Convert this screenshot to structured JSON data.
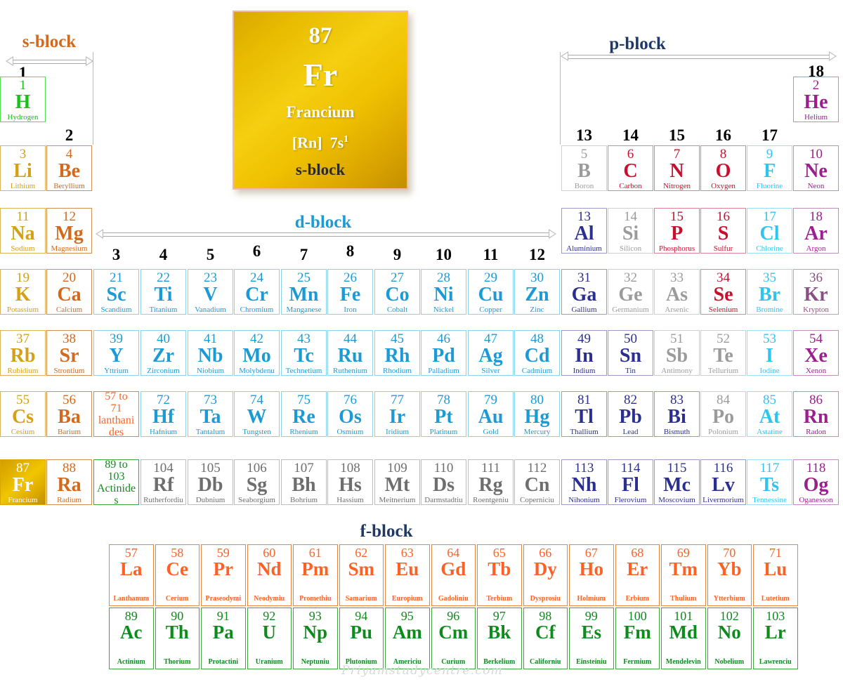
{
  "blocks": {
    "s_label": "s-block",
    "p_label": "p-block",
    "d_label": "d-block",
    "f_label": "f-block"
  },
  "colors": {
    "group1": "#d4a017",
    "group2": "#d2691e",
    "dblock": "#1c9ad6",
    "dblock_gray": "#6e6e6e",
    "hydrogen": "#18c018",
    "metal_navy": "#2b2f8f",
    "metalloid_gray": "#9b9b9b",
    "nonmetal_crimson": "#c8102e",
    "halogen_cyan": "#2ec4f0",
    "noble_purple": "#9b1f8f",
    "lanthanide_orange": "#ff6024",
    "actinide_green": "#0f8a1c",
    "card_gold": "#e8bc00",
    "card_border": "#f0b9a0"
  },
  "group_numbers": [
    "1",
    "2",
    "3",
    "4",
    "5",
    "6",
    "7",
    "8",
    "9",
    "10",
    "11",
    "12",
    "13",
    "14",
    "15",
    "16",
    "17",
    "18"
  ],
  "feature_card": {
    "number": "87",
    "symbol": "Fr",
    "name": "Francium",
    "config_core": "[Rn]",
    "config_orbital": "7s",
    "config_sup": "1",
    "block": "s-block"
  },
  "placeholders": [
    {
      "line1": "57 to",
      "line2": "71",
      "line3": "lanthani",
      "line4": "des",
      "color": "#ff6024",
      "border": "#e8853c"
    },
    {
      "line1": "89 to",
      "line2": "103",
      "line3": "Actinide",
      "line4": "s",
      "color": "#0f8a1c",
      "border": "#3da83d"
    }
  ],
  "elements": [
    {
      "z": "1",
      "sym": "H",
      "name": "Hydrogen",
      "col": 1,
      "row": 1,
      "color": "#18c018",
      "border": "#4ee04e"
    },
    {
      "z": "2",
      "sym": "He",
      "name": "Helium",
      "col": 18,
      "row": 1,
      "color": "#9b1f8f",
      "border": "#c08fc0"
    },
    {
      "z": "3",
      "sym": "Li",
      "name": "Lithium",
      "col": 1,
      "row": 2,
      "color": "#d4a017",
      "border": "#d9b45a"
    },
    {
      "z": "4",
      "sym": "Be",
      "name": "Beryllium",
      "col": 2,
      "row": 2,
      "color": "#d2691e",
      "border": "#cf9052"
    },
    {
      "z": "5",
      "sym": "B",
      "name": "Boron",
      "col": 13,
      "row": 2,
      "color": "#9b9b9b",
      "border": "#cfcfcf"
    },
    {
      "z": "6",
      "sym": "C",
      "name": "Carbon",
      "col": 14,
      "row": 2,
      "color": "#c8102e",
      "border": "#e08296"
    },
    {
      "z": "7",
      "sym": "N",
      "name": "Nitrogen",
      "col": 15,
      "row": 2,
      "color": "#c8102e",
      "border": "#e08296"
    },
    {
      "z": "8",
      "sym": "O",
      "name": "Oxygen",
      "col": 16,
      "row": 2,
      "color": "#c8102e",
      "border": "#e08296"
    },
    {
      "z": "9",
      "sym": "F",
      "name": "Fluorine",
      "col": 17,
      "row": 2,
      "color": "#2ec4f0",
      "border": "#9adef5"
    },
    {
      "z": "10",
      "sym": "Ne",
      "name": "Neon",
      "col": 18,
      "row": 2,
      "color": "#9b1f8f",
      "border": "#c08fc0"
    },
    {
      "z": "11",
      "sym": "Na",
      "name": "Sodium",
      "col": 1,
      "row": 3,
      "color": "#d4a017",
      "border": "#d9b45a"
    },
    {
      "z": "12",
      "sym": "Mg",
      "name": "Magnesium",
      "col": 2,
      "row": 3,
      "color": "#d2691e",
      "border": "#cf9052"
    },
    {
      "z": "13",
      "sym": "Al",
      "name": "Aluminium",
      "col": 13,
      "row": 3,
      "color": "#2b2f8f",
      "border": "#9a9cc8"
    },
    {
      "z": "14",
      "sym": "Si",
      "name": "Silicon",
      "col": 14,
      "row": 3,
      "color": "#9b9b9b",
      "border": "#cfcfcf"
    },
    {
      "z": "15",
      "sym": "P",
      "name": "Phosphorus",
      "col": 15,
      "row": 3,
      "color": "#c8102e",
      "border": "#e08296"
    },
    {
      "z": "16",
      "sym": "S",
      "name": "Sulfur",
      "col": 16,
      "row": 3,
      "color": "#c8102e",
      "border": "#e08296"
    },
    {
      "z": "17",
      "sym": "Cl",
      "name": "Chlorine",
      "col": 17,
      "row": 3,
      "color": "#2ec4f0",
      "border": "#9adef5"
    },
    {
      "z": "18",
      "sym": "Ar",
      "name": "Argon",
      "col": 18,
      "row": 3,
      "color": "#9b1f8f",
      "border": "#c08fc0"
    },
    {
      "z": "19",
      "sym": "K",
      "name": "Potassium",
      "col": 1,
      "row": 4,
      "color": "#d4a017",
      "border": "#d9b45a"
    },
    {
      "z": "20",
      "sym": "Ca",
      "name": "Calcium",
      "col": 2,
      "row": 4,
      "color": "#d2691e",
      "border": "#cf9052"
    },
    {
      "z": "21",
      "sym": "Sc",
      "name": "Scandium",
      "col": 3,
      "row": 4,
      "color": "#1c9ad6",
      "border": "#8fd0ea"
    },
    {
      "z": "22",
      "sym": "Ti",
      "name": "Titanium",
      "col": 4,
      "row": 4,
      "color": "#1c9ad6",
      "border": "#8fd0ea"
    },
    {
      "z": "23",
      "sym": "V",
      "name": "Vanadium",
      "col": 5,
      "row": 4,
      "color": "#1c9ad6",
      "border": "#8fd0ea"
    },
    {
      "z": "24",
      "sym": "Cr",
      "name": "Chromium",
      "col": 6,
      "row": 4,
      "color": "#1c9ad6",
      "border": "#8fd0ea"
    },
    {
      "z": "25",
      "sym": "Mn",
      "name": "Manganese",
      "col": 7,
      "row": 4,
      "color": "#1c9ad6",
      "border": "#8fd0ea"
    },
    {
      "z": "26",
      "sym": "Fe",
      "name": "Iron",
      "col": 8,
      "row": 4,
      "color": "#1c9ad6",
      "border": "#8fd0ea"
    },
    {
      "z": "27",
      "sym": "Co",
      "name": "Cobalt",
      "col": 9,
      "row": 4,
      "color": "#1c9ad6",
      "border": "#8fd0ea"
    },
    {
      "z": "28",
      "sym": "Ni",
      "name": "Nickel",
      "col": 10,
      "row": 4,
      "color": "#1c9ad6",
      "border": "#8fd0ea"
    },
    {
      "z": "29",
      "sym": "Cu",
      "name": "Copper",
      "col": 11,
      "row": 4,
      "color": "#1c9ad6",
      "border": "#8fd0ea"
    },
    {
      "z": "30",
      "sym": "Zn",
      "name": "Zinc",
      "col": 12,
      "row": 4,
      "color": "#1c9ad6",
      "border": "#8fd0ea"
    },
    {
      "z": "31",
      "sym": "Ga",
      "name": "Gallium",
      "col": 13,
      "row": 4,
      "color": "#2b2f8f",
      "border": "#9a9cc8"
    },
    {
      "z": "32",
      "sym": "Ge",
      "name": "Germanium",
      "col": 14,
      "row": 4,
      "color": "#9b9b9b",
      "border": "#cfcfcf"
    },
    {
      "z": "33",
      "sym": "As",
      "name": "Arsenic",
      "col": 15,
      "row": 4,
      "color": "#9b9b9b",
      "border": "#cfcfcf"
    },
    {
      "z": "34",
      "sym": "Se",
      "name": "Selenium",
      "col": 16,
      "row": 4,
      "color": "#c8102e",
      "border": "#e08296"
    },
    {
      "z": "35",
      "sym": "Br",
      "name": "Bromine",
      "col": 17,
      "row": 4,
      "color": "#2ec4f0",
      "border": "#9adef5"
    },
    {
      "z": "36",
      "sym": "Kr",
      "name": "Krypton",
      "col": 18,
      "row": 4,
      "color": "#8b4f86",
      "border": "#c0a0bd"
    },
    {
      "z": "37",
      "sym": "Rb",
      "name": "Rubidium",
      "col": 1,
      "row": 5,
      "color": "#d4a017",
      "border": "#d9b45a"
    },
    {
      "z": "38",
      "sym": "Sr",
      "name": "Strontium",
      "col": 2,
      "row": 5,
      "color": "#d2691e",
      "border": "#cf9052"
    },
    {
      "z": "39",
      "sym": "Y",
      "name": "Yttrium",
      "col": 3,
      "row": 5,
      "color": "#1c9ad6",
      "border": "#8fd0ea"
    },
    {
      "z": "40",
      "sym": "Zr",
      "name": "Zirconium",
      "col": 4,
      "row": 5,
      "color": "#1c9ad6",
      "border": "#8fd0ea"
    },
    {
      "z": "41",
      "sym": "Nb",
      "name": "Niobium",
      "col": 5,
      "row": 5,
      "color": "#1c9ad6",
      "border": "#8fd0ea"
    },
    {
      "z": "42",
      "sym": "Mo",
      "name": "Molybdenu",
      "col": 6,
      "row": 5,
      "color": "#1c9ad6",
      "border": "#8fd0ea"
    },
    {
      "z": "43",
      "sym": "Tc",
      "name": "Technetium",
      "col": 7,
      "row": 5,
      "color": "#1c9ad6",
      "border": "#8fd0ea"
    },
    {
      "z": "44",
      "sym": "Ru",
      "name": "Ruthenium",
      "col": 8,
      "row": 5,
      "color": "#1c9ad6",
      "border": "#8fd0ea"
    },
    {
      "z": "45",
      "sym": "Rh",
      "name": "Rhodium",
      "col": 9,
      "row": 5,
      "color": "#1c9ad6",
      "border": "#8fd0ea"
    },
    {
      "z": "46",
      "sym": "Pd",
      "name": "Palladium",
      "col": 10,
      "row": 5,
      "color": "#1c9ad6",
      "border": "#8fd0ea"
    },
    {
      "z": "47",
      "sym": "Ag",
      "name": "Silver",
      "col": 11,
      "row": 5,
      "color": "#1c9ad6",
      "border": "#8fd0ea"
    },
    {
      "z": "48",
      "sym": "Cd",
      "name": "Cadmium",
      "col": 12,
      "row": 5,
      "color": "#1c9ad6",
      "border": "#8fd0ea"
    },
    {
      "z": "49",
      "sym": "In",
      "name": "Indium",
      "col": 13,
      "row": 5,
      "color": "#2b2f8f",
      "border": "#9a9cc8"
    },
    {
      "z": "50",
      "sym": "Sn",
      "name": "Tin",
      "col": 14,
      "row": 5,
      "color": "#2b2f8f",
      "border": "#9a9cc8"
    },
    {
      "z": "51",
      "sym": "Sb",
      "name": "Antimony",
      "col": 15,
      "row": 5,
      "color": "#9b9b9b",
      "border": "#cfcfcf"
    },
    {
      "z": "52",
      "sym": "Te",
      "name": "Tellurium",
      "col": 16,
      "row": 5,
      "color": "#9b9b9b",
      "border": "#cfcfcf"
    },
    {
      "z": "53",
      "sym": "I",
      "name": "Iodine",
      "col": 17,
      "row": 5,
      "color": "#2ec4f0",
      "border": "#9adef5"
    },
    {
      "z": "54",
      "sym": "Xe",
      "name": "Xenon",
      "col": 18,
      "row": 5,
      "color": "#9b1f8f",
      "border": "#c08fc0"
    },
    {
      "z": "55",
      "sym": "Cs",
      "name": "Cesium",
      "col": 1,
      "row": 6,
      "color": "#d4a017",
      "border": "#d9b45a"
    },
    {
      "z": "56",
      "sym": "Ba",
      "name": "Barium",
      "col": 2,
      "row": 6,
      "color": "#d2691e",
      "border": "#cf9052"
    },
    {
      "z": "72",
      "sym": "Hf",
      "name": "Hafnium",
      "col": 4,
      "row": 6,
      "color": "#1c9ad6",
      "border": "#8fd0ea"
    },
    {
      "z": "73",
      "sym": "Ta",
      "name": "Tantalum",
      "col": 5,
      "row": 6,
      "color": "#1c9ad6",
      "border": "#8fd0ea"
    },
    {
      "z": "74",
      "sym": "W",
      "name": "Tungsten",
      "col": 6,
      "row": 6,
      "color": "#1c9ad6",
      "border": "#8fd0ea"
    },
    {
      "z": "75",
      "sym": "Re",
      "name": "Rhenium",
      "col": 7,
      "row": 6,
      "color": "#1c9ad6",
      "border": "#8fd0ea"
    },
    {
      "z": "76",
      "sym": "Os",
      "name": "Osmium",
      "col": 8,
      "row": 6,
      "color": "#1c9ad6",
      "border": "#8fd0ea"
    },
    {
      "z": "77",
      "sym": "Ir",
      "name": "Iridium",
      "col": 9,
      "row": 6,
      "color": "#1c9ad6",
      "border": "#8fd0ea"
    },
    {
      "z": "78",
      "sym": "Pt",
      "name": "Platinum",
      "col": 10,
      "row": 6,
      "color": "#1c9ad6",
      "border": "#8fd0ea"
    },
    {
      "z": "79",
      "sym": "Au",
      "name": "Gold",
      "col": 11,
      "row": 6,
      "color": "#1c9ad6",
      "border": "#8fd0ea"
    },
    {
      "z": "80",
      "sym": "Hg",
      "name": "Mercury",
      "col": 12,
      "row": 6,
      "color": "#1c9ad6",
      "border": "#8fd0ea"
    },
    {
      "z": "81",
      "sym": "Tl",
      "name": "Thallium",
      "col": 13,
      "row": 6,
      "color": "#2b2f8f",
      "border": "#9a9cc8"
    },
    {
      "z": "82",
      "sym": "Pb",
      "name": "Lead",
      "col": 14,
      "row": 6,
      "color": "#2b2f8f",
      "border": "#9a9cc8"
    },
    {
      "z": "83",
      "sym": "Bi",
      "name": "Bismuth",
      "col": 15,
      "row": 6,
      "color": "#2b2f8f",
      "border": "#9a9cc8"
    },
    {
      "z": "84",
      "sym": "Po",
      "name": "Polonium",
      "col": 16,
      "row": 6,
      "color": "#9b9b9b",
      "border": "#cfcfcf"
    },
    {
      "z": "85",
      "sym": "At",
      "name": "Astatine",
      "col": 17,
      "row": 6,
      "color": "#2ec4f0",
      "border": "#9adef5"
    },
    {
      "z": "86",
      "sym": "Rn",
      "name": "Radon",
      "col": 18,
      "row": 6,
      "color": "#9b1f8f",
      "border": "#c08fc0"
    },
    {
      "z": "87",
      "sym": "Fr",
      "name": "Francium",
      "col": 1,
      "row": 7,
      "color": "#ffffff",
      "border": "#d8a800",
      "highlight": true
    },
    {
      "z": "88",
      "sym": "Ra",
      "name": "Radium",
      "col": 2,
      "row": 7,
      "color": "#d2691e",
      "border": "#cf9052"
    },
    {
      "z": "104",
      "sym": "Rf",
      "name": "Rutherfordiu",
      "col": 4,
      "row": 7,
      "color": "#6e6e6e",
      "border": "#bdbdbd"
    },
    {
      "z": "105",
      "sym": "Db",
      "name": "Dubnium",
      "col": 5,
      "row": 7,
      "color": "#6e6e6e",
      "border": "#bdbdbd"
    },
    {
      "z": "106",
      "sym": "Sg",
      "name": "Seaborgium",
      "col": 6,
      "row": 7,
      "color": "#6e6e6e",
      "border": "#bdbdbd"
    },
    {
      "z": "107",
      "sym": "Bh",
      "name": "Bohrium",
      "col": 7,
      "row": 7,
      "color": "#6e6e6e",
      "border": "#bdbdbd"
    },
    {
      "z": "108",
      "sym": "Hs",
      "name": "Hassium",
      "col": 8,
      "row": 7,
      "color": "#6e6e6e",
      "border": "#bdbdbd"
    },
    {
      "z": "109",
      "sym": "Mt",
      "name": "Meitnerium",
      "col": 9,
      "row": 7,
      "color": "#6e6e6e",
      "border": "#bdbdbd"
    },
    {
      "z": "110",
      "sym": "Ds",
      "name": "Darmstadtiu",
      "col": 10,
      "row": 7,
      "color": "#6e6e6e",
      "border": "#bdbdbd"
    },
    {
      "z": "111",
      "sym": "Rg",
      "name": "Roentgeniu",
      "col": 11,
      "row": 7,
      "color": "#6e6e6e",
      "border": "#bdbdbd"
    },
    {
      "z": "112",
      "sym": "Cn",
      "name": "Coperniciu",
      "col": 12,
      "row": 7,
      "color": "#6e6e6e",
      "border": "#bdbdbd"
    },
    {
      "z": "113",
      "sym": "Nh",
      "name": "Nihonium",
      "col": 13,
      "row": 7,
      "color": "#2b2f8f",
      "border": "#9a9cc8"
    },
    {
      "z": "114",
      "sym": "Fl",
      "name": "Flerovium",
      "col": 14,
      "row": 7,
      "color": "#2b2f8f",
      "border": "#9a9cc8"
    },
    {
      "z": "115",
      "sym": "Mc",
      "name": "Moscovium",
      "col": 15,
      "row": 7,
      "color": "#2b2f8f",
      "border": "#9a9cc8"
    },
    {
      "z": "116",
      "sym": "Lv",
      "name": "Livermorium",
      "col": 16,
      "row": 7,
      "color": "#2b2f8f",
      "border": "#9a9cc8"
    },
    {
      "z": "117",
      "sym": "Ts",
      "name": "Tennessine",
      "col": 17,
      "row": 7,
      "color": "#2ec4f0",
      "border": "#9adef5"
    },
    {
      "z": "118",
      "sym": "Og",
      "name": "Oganesson",
      "col": 18,
      "row": 7,
      "color": "#9b1f8f",
      "border": "#c08fc0"
    }
  ],
  "lanthanides": [
    {
      "z": "57",
      "sym": "La",
      "name": "Lanthanum"
    },
    {
      "z": "58",
      "sym": "Ce",
      "name": "Cerium"
    },
    {
      "z": "59",
      "sym": "Pr",
      "name": "Praseodymi"
    },
    {
      "z": "60",
      "sym": "Nd",
      "name": "Neodymiu"
    },
    {
      "z": "61",
      "sym": "Pm",
      "name": "Promethiu"
    },
    {
      "z": "62",
      "sym": "Sm",
      "name": "Samarium"
    },
    {
      "z": "63",
      "sym": "Eu",
      "name": "Europium"
    },
    {
      "z": "64",
      "sym": "Gd",
      "name": "Gadoliniu"
    },
    {
      "z": "65",
      "sym": "Tb",
      "name": "Terbium"
    },
    {
      "z": "66",
      "sym": "Dy",
      "name": "Dysprosiu"
    },
    {
      "z": "67",
      "sym": "Ho",
      "name": "Holmium"
    },
    {
      "z": "68",
      "sym": "Er",
      "name": "Erbium"
    },
    {
      "z": "69",
      "sym": "Tm",
      "name": "Thulium"
    },
    {
      "z": "70",
      "sym": "Yb",
      "name": "Ytterbium"
    },
    {
      "z": "71",
      "sym": "Lu",
      "name": "Lutetium"
    }
  ],
  "actinides": [
    {
      "z": "89",
      "sym": "Ac",
      "name": "Actinium"
    },
    {
      "z": "90",
      "sym": "Th",
      "name": "Thorium"
    },
    {
      "z": "91",
      "sym": "Pa",
      "name": "Protactini"
    },
    {
      "z": "92",
      "sym": "U",
      "name": "Uranium"
    },
    {
      "z": "93",
      "sym": "Np",
      "name": "Neptuniu"
    },
    {
      "z": "94",
      "sym": "Pu",
      "name": "Plutonium"
    },
    {
      "z": "95",
      "sym": "Am",
      "name": "Americiu"
    },
    {
      "z": "96",
      "sym": "Cm",
      "name": "Curium"
    },
    {
      "z": "97",
      "sym": "Bk",
      "name": "Berkelium"
    },
    {
      "z": "98",
      "sym": "Cf",
      "name": "Californiu"
    },
    {
      "z": "99",
      "sym": "Es",
      "name": "Einsteiniu"
    },
    {
      "z": "100",
      "sym": "Fm",
      "name": "Fermium"
    },
    {
      "z": "101",
      "sym": "Md",
      "name": "Mendelevin"
    },
    {
      "z": "102",
      "sym": "No",
      "name": "Nobelium"
    },
    {
      "z": "103",
      "sym": "Lr",
      "name": "Lawrenciu"
    }
  ],
  "watermark": "Priyamstudycentre.com"
}
